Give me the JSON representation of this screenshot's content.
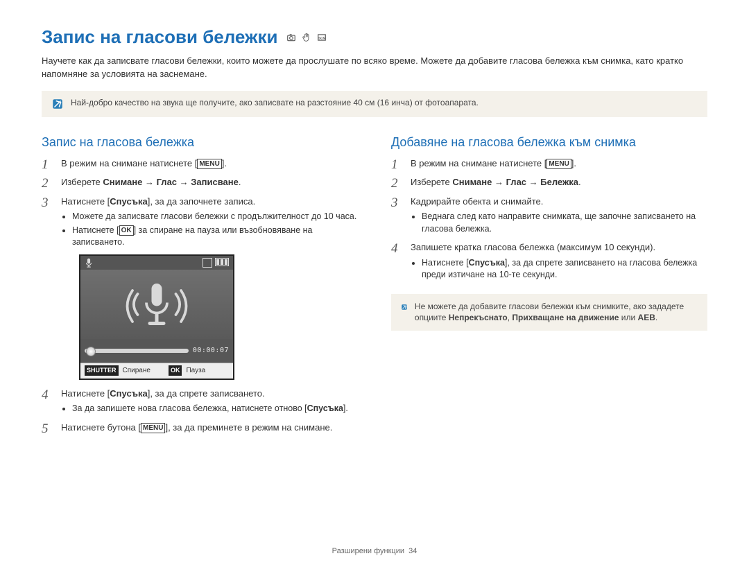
{
  "header": {
    "title": "Запис на гласови бележки",
    "mode_icons": [
      "camera-icon",
      "hand-icon",
      "scene-icon"
    ]
  },
  "intro": "Научете как да записвате гласови бележки, които можете да прослушате по всяко време. Можете да добавите гласова бележка към снимка, като кратко напомняне за условията на заснемане.",
  "note_top": "Най-добро качество на звука ще получите, ако записвате на разстояние 40 см (16 инча) от фотоапарата.",
  "left": {
    "title": "Запис на гласова бележка",
    "step1_a": "В режим на снимане натиснете [",
    "step1_btn": "MENU",
    "step1_b": "].",
    "step2_a": "Изберете ",
    "step2_b": "Снимане → Глас → Записване",
    "step2_c": ".",
    "step3_a": "Натиснете [",
    "step3_b": "Спусъка",
    "step3_c": "], за да започнете записа.",
    "step3_bullets": [
      "Можете да записвате гласови бележки с продължителност до 10 часа.",
      "Натиснете [          ] за спиране на пауза или възобновяване на записването."
    ],
    "step3_ok": "OK",
    "lcd": {
      "timecode": "00:00:07",
      "shutter_label": "SHUTTER",
      "stop_label": "Спиране",
      "ok_label": "OK",
      "pause_label": "Пауза"
    },
    "step4_a": "Натиснете [",
    "step4_b": "Спусъка",
    "step4_c": "], за да спрете записването.",
    "step4_bullet_a": "За да запишете нова гласова бележка, натиснете отново [",
    "step4_bullet_b": "Спусъка",
    "step4_bullet_c": "].",
    "step5_a": "Натиснете бутона [",
    "step5_btn": "MENU",
    "step5_b": "], за да преминете в режим на снимане."
  },
  "right": {
    "title": "Добавяне на гласова бележка към снимка",
    "step1_a": "В режим на снимане натиснете [",
    "step1_btn": "MENU",
    "step1_b": "].",
    "step2_a": "Изберете ",
    "step2_b": "Снимане → Глас → Бележка",
    "step2_c": ".",
    "step3": "Кадрирайте обекта и снимайте.",
    "step3_bullets": [
      "Веднага след като направите снимката, ще започне записването на гласова бележка."
    ],
    "step4": "Запишете кратка гласова бележка (максимум 10 секунди).",
    "step4_bullet_a": "Натиснете [",
    "step4_bullet_b": "Спусъка",
    "step4_bullet_c": "], за да спрете записването на гласова бележка преди изтичане на 10-те секунди.",
    "note_a": "Не можете да добавите гласови бележки към снимките, ако зададете опциите ",
    "note_b": "Непрекъснато",
    "note_c": ", ",
    "note_d": "Прихващане на движение",
    "note_e": " или ",
    "note_f": "AEB",
    "note_g": "."
  },
  "footer": {
    "section": "Разширени функции",
    "page": "34"
  }
}
